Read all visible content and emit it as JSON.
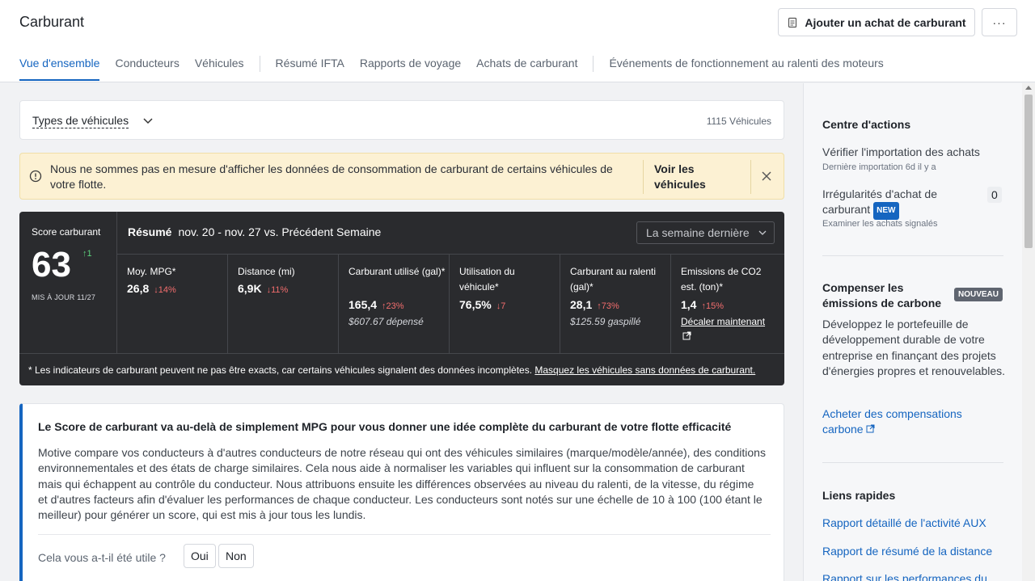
{
  "header": {
    "title": "Carburant",
    "add_purchase_label": "Ajouter un achat de carburant",
    "more_label": "···"
  },
  "tabs": [
    {
      "label": "Vue d'ensemble",
      "active": true
    },
    {
      "label": "Conducteurs"
    },
    {
      "label": "Véhicules"
    },
    {
      "label": "Résumé IFTA"
    },
    {
      "label": "Rapports de voyage"
    },
    {
      "label": "Achats de carburant"
    },
    {
      "label": "Événements de fonctionnement au ralenti des moteurs"
    }
  ],
  "vehicle_types": {
    "label": "Types de véhicules",
    "count": "1115 Véhicules"
  },
  "banner": {
    "text": "Nous ne sommes pas en mesure d'afficher les données de consommation de carburant de certains véhicules de votre flotte.",
    "link": "Voir les véhicules",
    "color": "#fcf1d3"
  },
  "score": {
    "label": "Score carburant",
    "value": "63",
    "delta": "↑1",
    "updated": "MIS À JOUR 11/27"
  },
  "summary": {
    "title": "Résumé",
    "range": "nov. 20 - nov. 27 vs. Précédent Semaine",
    "period": "La semaine dernière"
  },
  "metrics": [
    {
      "label": "Moy. MPG*",
      "value": "26,8",
      "delta": "↓14%"
    },
    {
      "label": "Distance (mi)",
      "value": "6,9K",
      "delta": "↓11%"
    },
    {
      "label": "Carburant utilisé (gal)*",
      "value": "165,4",
      "delta": "↑23%",
      "sub": "$607.67 dépensé"
    },
    {
      "label": "Utilisation du véhicule*",
      "value": "76,5%",
      "delta": "↓7"
    },
    {
      "label": "Carburant au ralenti (gal)*",
      "value": "28,1",
      "delta": "↑73%",
      "sub": "$125.59 gaspillé"
    },
    {
      "label": "Emissions de CO2 est. (ton)*",
      "value": "1,4",
      "delta": "↑15%",
      "link": "Décaler maintenant"
    }
  ],
  "footnote": {
    "text": "* Les indicateurs de carburant peuvent ne pas être exacts, car certains véhicules signalent des données incomplètes.",
    "link": "Masquez les véhicules sans données de carburant."
  },
  "info": {
    "title": "Le Score de carburant va au-delà de simplement MPG pour vous donner une idée complète du carburant de votre flotte efficacité",
    "body": "Motive compare vos conducteurs à d'autres conducteurs de notre réseau qui ont des véhicules similaires (marque/modèle/année), des conditions environnementales et des états de charge similaires. Cela nous aide à normaliser les variables qui influent sur la consommation de carburant mais qui échappent au contrôle du conducteur. Nous attribuons ensuite les différences observées au niveau du ralenti, de la vitesse, du régime et d'autres facteurs afin d'évaluer les performances de chaque conducteur. Les conducteurs sont notés sur une échelle de 10 à 100 (100 étant le meilleur) pour générer un score, qui est mis à jour tous les lundis.",
    "feedback_q": "Cela vous a-t-il été utile ?",
    "yes": "Oui",
    "no": "Non"
  },
  "sidebar": {
    "actions_title": "Centre d'actions",
    "verify_title": "Vérifier l'importation des achats",
    "verify_sub": "Dernière importation 6d il y a",
    "irreg_title": "Irrégularités d'achat de carburant",
    "irreg_badge": "NEW",
    "irreg_sub": "Examiner les achats signalés",
    "irreg_count": "0",
    "offset_title": "Compenser les émissions de carbone",
    "offset_badge": "NOUVEAU",
    "offset_body": "Développez le portefeuille de développement durable de votre entreprise en finançant des projets d'énergies propres et renouvelables.",
    "offset_link": "Acheter des compensations carbone",
    "quick_title": "Liens rapides",
    "quick_links": [
      "Rapport détaillé de l'activité AUX",
      "Rapport de résumé de la distance",
      "Rapport sur les performances du"
    ]
  },
  "colors": {
    "accent": "#1565c0",
    "dark_panel": "#2a2b2e",
    "up_green": "#5cd17c",
    "negative_red": "#f26d6d"
  }
}
